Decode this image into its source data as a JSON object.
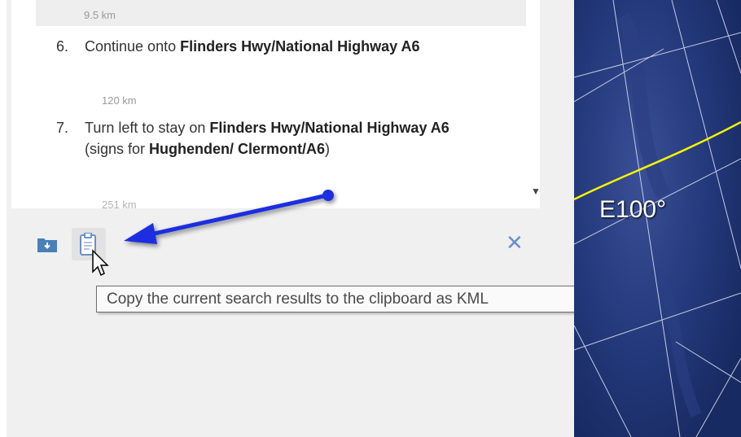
{
  "directions": {
    "partial_top_distance": "9.5 km",
    "steps": [
      {
        "num": "6.",
        "prefix": "Continue onto ",
        "road": "Flinders Hwy/National Highway A6",
        "distance": "120 km"
      },
      {
        "num": "7.",
        "prefix": "Turn left to stay on ",
        "road": "Flinders Hwy/National Highway A6",
        "mid": " (signs for ",
        "dest": "Hughenden/ Clermont/A6",
        "suffix": ")",
        "distance_clipped": "251 km"
      }
    ]
  },
  "toolbar": {
    "save_icon": "folder-download-icon",
    "copy_icon": "clipboard-icon",
    "close_symbol": "✕"
  },
  "tooltip": {
    "text": "Copy the current search results to the clipboard as KML"
  },
  "map": {
    "grid_label": "E100°",
    "line_color": "#f5f300",
    "background": "#1b2e69"
  },
  "annotation": {
    "arrow_color": "#1a2ee0"
  }
}
